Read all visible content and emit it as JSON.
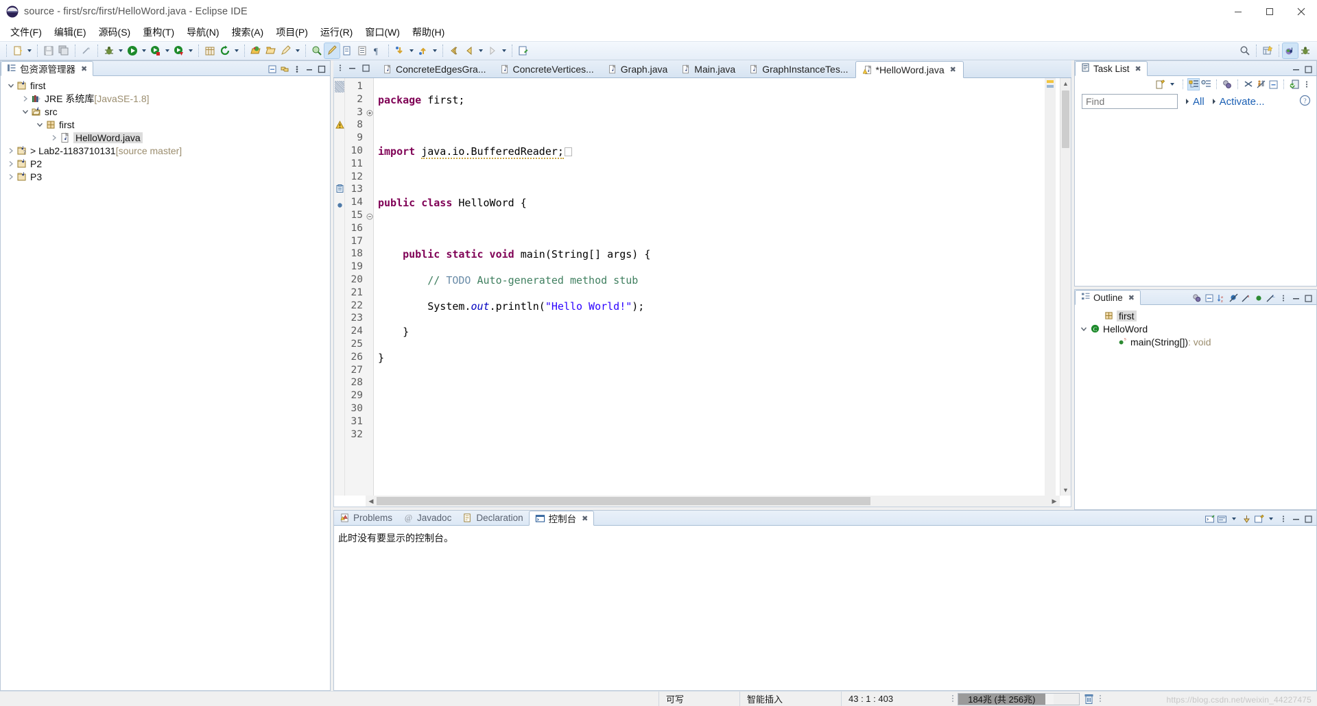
{
  "window": {
    "title": "source - first/src/first/HelloWord.java - Eclipse IDE",
    "minimize_label": "–",
    "maximize_label": "❐",
    "close_label": "✕"
  },
  "menubar": {
    "items": [
      {
        "label": "文件(F)",
        "name": "menu-file"
      },
      {
        "label": "编辑(E)",
        "name": "menu-edit"
      },
      {
        "label": "源码(S)",
        "name": "menu-source"
      },
      {
        "label": "重构(T)",
        "name": "menu-refactor"
      },
      {
        "label": "导航(N)",
        "name": "menu-navigate"
      },
      {
        "label": "搜索(A)",
        "name": "menu-search"
      },
      {
        "label": "项目(P)",
        "name": "menu-project"
      },
      {
        "label": "运行(R)",
        "name": "menu-run"
      },
      {
        "label": "窗口(W)",
        "name": "menu-window"
      },
      {
        "label": "帮助(H)",
        "name": "menu-help"
      }
    ]
  },
  "toolbar": {
    "icons": [
      "new-wizard-icon",
      "save-icon",
      "save-all-icon",
      "print-disabled-icon",
      "debug-icon",
      "run-icon",
      "coverage-icon",
      "external-tools-icon",
      "new-java-project-icon",
      "refresh-icon",
      "open-type-icon",
      "open-task-icon",
      "edit-icon",
      "search-icon",
      "toggle-mark-occurrences-icon",
      "new-java-class-icon",
      "new-package-icon",
      "show-whitespace-icon",
      "next-annotation-icon",
      "previous-annotation-icon",
      "back-icon",
      "forward-icon",
      "last-edit-icon"
    ],
    "right_icons": [
      "search-icon",
      "new-perspective-icon",
      "java-perspective-icon",
      "debug-perspective-icon"
    ]
  },
  "package_explorer": {
    "tab_label": "包资源管理器",
    "tab_icon": "package-explorer-icon",
    "close_label": "✖",
    "tool_icons": [
      "collapse-all-icon",
      "link-with-editor-icon",
      "view-menu-icon",
      "minimize-icon",
      "maximize-icon"
    ],
    "tree": [
      {
        "label": "first",
        "indent": 0,
        "twist": "expanded",
        "icon": "java-project-icon",
        "suffix": "",
        "selected": false
      },
      {
        "label": "JRE 系统库",
        "indent": 1,
        "twist": "collapsed",
        "icon": "jre-library-icon",
        "suffix": "[JavaSE-1.8]",
        "selected": false
      },
      {
        "label": "src",
        "indent": 1,
        "twist": "expanded",
        "icon": "source-folder-icon",
        "suffix": "",
        "selected": false
      },
      {
        "label": "first",
        "indent": 2,
        "twist": "expanded",
        "icon": "package-icon",
        "suffix": "",
        "selected": false
      },
      {
        "label": "HelloWord.java",
        "indent": 3,
        "twist": "collapsed",
        "icon": "java-file-icon",
        "suffix": "",
        "selected": true
      },
      {
        "label": "> Lab2-1183710131",
        "indent": 0,
        "twist": "collapsed",
        "icon": "java-project-git-icon",
        "suffix": "[source master]",
        "selected": false
      },
      {
        "label": "P2",
        "indent": 0,
        "twist": "collapsed",
        "icon": "java-project-icon",
        "suffix": "",
        "selected": false
      },
      {
        "label": "P3",
        "indent": 0,
        "twist": "collapsed",
        "icon": "java-project-icon",
        "suffix": "",
        "selected": false
      }
    ]
  },
  "editor": {
    "tabs": [
      {
        "label": "ConcreteEdgesGra...",
        "active": false,
        "dirty": false,
        "icon": "java-file-icon"
      },
      {
        "label": "ConcreteVertices...",
        "active": false,
        "dirty": false,
        "icon": "java-file-icon"
      },
      {
        "label": "Graph.java",
        "active": false,
        "dirty": false,
        "icon": "java-file-icon"
      },
      {
        "label": "Main.java",
        "active": false,
        "dirty": false,
        "icon": "java-file-icon"
      },
      {
        "label": "GraphInstanceTes...",
        "active": false,
        "dirty": false,
        "icon": "java-file-icon"
      },
      {
        "label": "*HelloWord.java",
        "active": true,
        "dirty": true,
        "icon": "java-file-warning-icon"
      }
    ],
    "tab_close_label": "✖",
    "minimize_label": "–",
    "maximize_label": "❐",
    "line_numbers": [
      "1",
      "2",
      "3",
      "8",
      "9",
      "10",
      "11",
      "12",
      "13",
      "14",
      "15",
      "16",
      "17",
      "18",
      "19",
      "20",
      "21",
      "22",
      "23",
      "24",
      "25",
      "26",
      "27",
      "28",
      "29",
      "30",
      "31",
      "32"
    ],
    "code_lines": [
      "package first;",
      "",
      "import java.io.BufferedReader;",
      "",
      "public class HelloWord {",
      "",
      "    public static void main(String[] args) {",
      "        // TODO Auto-generated method stub",
      "        System.out.println(\"Hello World!\");",
      "    }",
      "}"
    ],
    "markers": [
      "warning-marker-icon",
      "todo-task-icon",
      "breakpoint-bullet-icon"
    ]
  },
  "task_list": {
    "tab_label": "Task List",
    "tab_icon": "task-list-icon",
    "close_label": "✖",
    "find_placeholder": "Find",
    "find_value": "",
    "filter_all": "All",
    "filter_activate": "Activate...",
    "help_label": "?",
    "tool_icons": [
      "new-task-icon",
      "categorized-icon",
      "scheduled-icon",
      "presentation-icon",
      "filter-icon",
      "focus-icon",
      "collapse-all-icon",
      "synchronize-icon",
      "view-menu-icon"
    ],
    "minimize_label": "–",
    "maximize_label": "❐"
  },
  "outline": {
    "tab_label": "Outline",
    "tab_icon": "outline-icon",
    "close_label": "✖",
    "tool_icons": [
      "focus-icon",
      "collapse-all-icon",
      "sort-icon",
      "hide-fields-icon",
      "hide-static-icon",
      "hide-nonpublic-icon",
      "hide-local-icon",
      "view-menu-icon"
    ],
    "minimize_label": "–",
    "maximize_label": "❐",
    "items": [
      {
        "label": "first",
        "suffix": "",
        "indent": 1,
        "icon": "package-icon",
        "twist": "",
        "selected": true
      },
      {
        "label": "HelloWord",
        "suffix": "",
        "indent": 0,
        "icon": "class-icon",
        "twist": "expanded",
        "selected": false
      },
      {
        "label": "main(String[])",
        "suffix": " : void",
        "indent": 2,
        "icon": "public-static-method-icon",
        "twist": "",
        "selected": false
      }
    ]
  },
  "bottom_panel": {
    "tabs": [
      {
        "label": "Problems",
        "icon": "problems-icon",
        "active": false
      },
      {
        "label": "Javadoc",
        "icon": "javadoc-icon",
        "active": false
      },
      {
        "label": "Declaration",
        "icon": "declaration-icon",
        "active": false
      },
      {
        "label": "控制台",
        "icon": "console-icon",
        "active": true
      }
    ],
    "close_label": "✖",
    "message": "此时没有要显示的控制台。",
    "tool_icons": [
      "open-console-icon",
      "display-selected-console-icon",
      "pin-console-icon",
      "new-console-view-icon",
      "view-menu-icon",
      "minimize-icon",
      "maximize-icon"
    ]
  },
  "statusbar": {
    "writable": "可写",
    "insert_mode": "智能插入",
    "position": "43 : 1 : 403",
    "heap_used": "184兆 (共 256兆)",
    "heap_percent": 72,
    "trash_icon": "trash-icon",
    "watermark": "https://blog.csdn.net/weixin_44227475"
  },
  "colors": {
    "accent": "#cde3f8",
    "tab_active_bg": "#ffffff",
    "keyword": "#7f0055",
    "string": "#2a00ff",
    "comment": "#3f7f5f",
    "field": "#0000c0",
    "panel_border": "#a7bdd4"
  }
}
